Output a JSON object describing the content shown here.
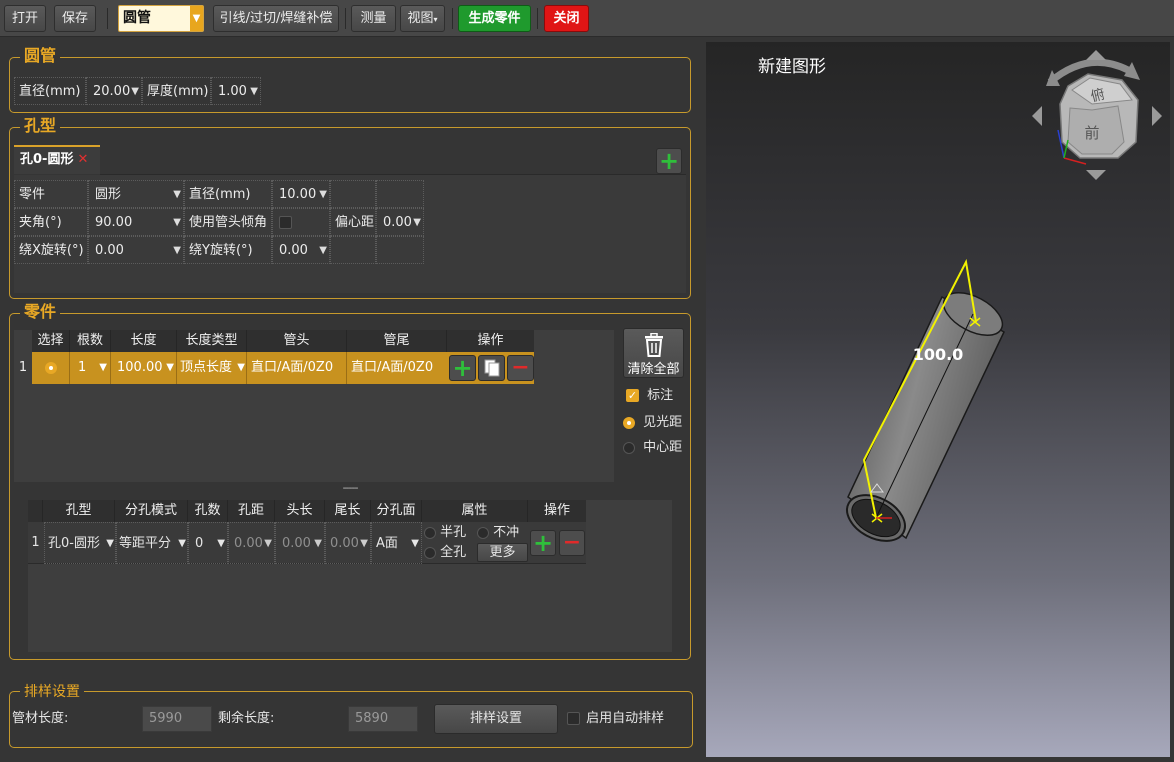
{
  "toolbar": {
    "open": "打开",
    "save": "保存",
    "shape_select": "圆管",
    "lead_cut": "引线/过切/焊缝补偿",
    "measure": "测量",
    "view": "视图",
    "generate": "生成零件",
    "close": "关闭"
  },
  "tube": {
    "title": "圆管",
    "diameter_label": "直径(mm)",
    "diameter_value": "20.00",
    "thickness_label": "厚度(mm)",
    "thickness_value": "1.00"
  },
  "hole": {
    "title": "孔型",
    "tab_label": "孔0-圆形",
    "part_label": "零件",
    "part_value": "圆形",
    "diameter_label": "直径(mm)",
    "diameter_value": "10.00",
    "angle_label": "夹角(°)",
    "angle_value": "90.00",
    "use_tube_tilt_label": "使用管头倾角",
    "eccentric_label": "偏心距",
    "eccentric_value": "0.00",
    "rot_x_label": "绕X旋转(°)",
    "rot_x_value": "0.00",
    "rot_y_label": "绕Y旋转(°)",
    "rot_y_value": "0.00"
  },
  "parts": {
    "title": "零件",
    "headers": [
      "选择",
      "根数",
      "长度",
      "长度类型",
      "管头",
      "管尾",
      "操作"
    ],
    "row": {
      "index": "1",
      "count": "1",
      "length": "100.00",
      "length_type": "顶点长度",
      "head": "直口/A面/0Z0",
      "tail": "直口/A面/0Z0"
    },
    "clear_all": "清除全部",
    "annotate": "标注",
    "see_light_distance": "见光距",
    "center_distance": "中心距",
    "splitter": "-----"
  },
  "holes_table": {
    "headers": [
      "孔型",
      "分孔模式",
      "孔数",
      "孔距",
      "头长",
      "尾长",
      "分孔面",
      "属性",
      "操作"
    ],
    "row": {
      "index": "1",
      "hole_type": "孔0-圆形",
      "split_mode": "等距平分",
      "count": "0",
      "spacing": "0.00",
      "head_len": "0.00",
      "tail_len": "0.00",
      "face": "A面",
      "half_hole": "半孔",
      "no_punch": "不冲",
      "full_hole": "全孔",
      "more": "更多"
    }
  },
  "nesting": {
    "title": "排样设置",
    "tube_length_label": "管材长度:",
    "tube_length_value": "5990",
    "remaining_label": "剩余长度:",
    "remaining_value": "5890",
    "settings_button": "排样设置",
    "auto_nest_label": "启用自动排样"
  },
  "viewport": {
    "title": "新建图形",
    "dimension": "100.0",
    "cube_top": "俯",
    "cube_front": "前"
  },
  "colors": {
    "accent": "#e8a825",
    "selected_row": "#c8921f",
    "add_green": "#2fbf3b",
    "remove_red": "#e02a2a",
    "generate_green": "#1f9a2d",
    "close_red": "#e01515"
  }
}
